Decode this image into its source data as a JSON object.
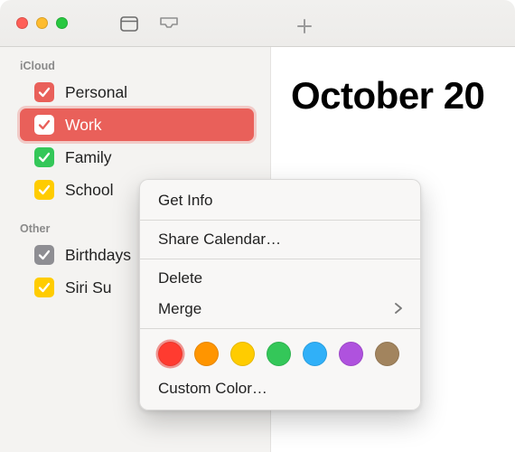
{
  "titlebar": {
    "buttons": {
      "calendar_view": "calendar-icon",
      "inbox": "tray-icon"
    },
    "add_label": "+"
  },
  "sidebar": {
    "sections": [
      {
        "label": "iCloud",
        "items": [
          {
            "name": "Personal",
            "color": "#e9605a",
            "checked": true
          },
          {
            "name": "Work",
            "color": "#e9605a",
            "checked": true,
            "selected": true
          },
          {
            "name": "Family",
            "color": "#34c759",
            "checked": true
          },
          {
            "name": "School",
            "color": "#ffcc00",
            "checked": true
          }
        ]
      },
      {
        "label": "Other",
        "items": [
          {
            "name": "Birthdays",
            "color": "#8e8e93",
            "checked": true
          },
          {
            "name": "Siri Suggestions",
            "color": "#ffcc00",
            "checked": true,
            "display": "Siri Su"
          }
        ]
      }
    ]
  },
  "main": {
    "month_title": "October 20"
  },
  "context_menu": {
    "target": "Work",
    "items": {
      "get_info": "Get Info",
      "share": "Share Calendar…",
      "delete": "Delete",
      "merge": "Merge",
      "custom_color": "Custom Color…"
    },
    "colors": [
      {
        "hex": "#ff3b30",
        "name": "red",
        "selected": true
      },
      {
        "hex": "#ff9500",
        "name": "orange"
      },
      {
        "hex": "#ffcc00",
        "name": "yellow"
      },
      {
        "hex": "#34c759",
        "name": "green"
      },
      {
        "hex": "#30b0f8",
        "name": "blue"
      },
      {
        "hex": "#af52de",
        "name": "purple"
      },
      {
        "hex": "#a2845e",
        "name": "brown"
      }
    ]
  }
}
